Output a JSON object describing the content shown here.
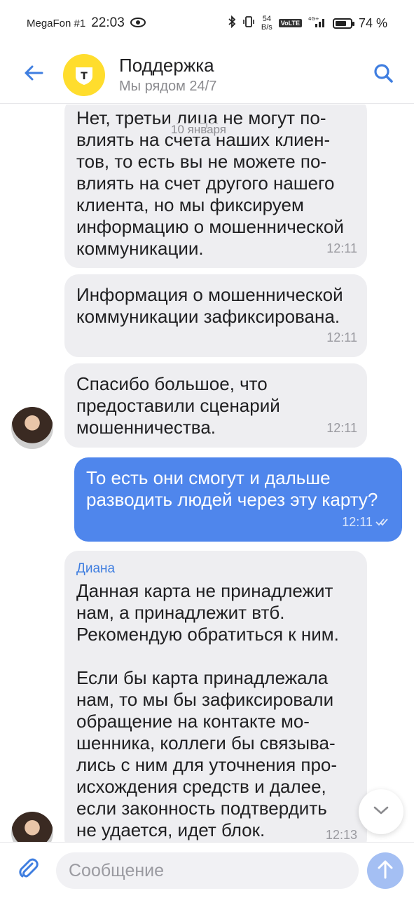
{
  "status_bar": {
    "carrier": "MegaFon #1",
    "time": "22:03",
    "speed_value": "54",
    "speed_unit": "B/s",
    "volte": "VoLTE",
    "network": "4G+",
    "battery": "74 %",
    "battery_level": 0.74
  },
  "header": {
    "title": "Поддержка",
    "subtitle": "Мы рядом 24/7",
    "logo_letter": "Т"
  },
  "chat": {
    "date_separator": "10 января",
    "messages": [
      {
        "direction": "in",
        "text": "Нет, третьи лица не могут по-\nвлиять на счета наших клиен-\nтов, то есть вы не можете по-\nвлиять на счет другого нашего\nклиента, но мы фиксируем\nинформацию о мошеннической\nкоммуникации.",
        "time": "12:11"
      },
      {
        "direction": "in",
        "text": "Информация о мошеннической\nкоммуникации зафиксирована.",
        "time": "12:11"
      },
      {
        "direction": "in",
        "text": "Спасибо большое, что\nпредоставили сценарий\nмошенничества.",
        "time": "12:11"
      },
      {
        "direction": "out",
        "text": "То есть они смогут и дальше\nразводить людей через эту карту?",
        "time": "12:11"
      },
      {
        "direction": "in",
        "sender": "Диана",
        "text": "Данная карта не принадлежит\nнам, а принадлежит втб.\nРекомендую обратиться к ним.\n\nЕсли бы карта принадлежала\nнам, то мы бы зафиксировали\nобращение на контакте мо-\nшенника, коллеги бы связыва-\nлись с ним для уточнения про-\nисхождения средств и далее,\nесли законность подтвердить\nне удается, идет блок.",
        "time": "12:13"
      }
    ]
  },
  "input": {
    "placeholder": "Сообщение",
    "value": ""
  },
  "icons": {
    "back": "arrow-left-icon",
    "search": "search-icon",
    "attach": "paperclip-icon",
    "send": "arrow-up-icon",
    "scroll": "chevron-down-icon",
    "read": "double-check-icon"
  },
  "colors": {
    "accent": "#4f86ec",
    "logo": "#ffdd2d",
    "incoming_bubble": "#eeeef1",
    "sender_name": "#3f7ee0"
  }
}
